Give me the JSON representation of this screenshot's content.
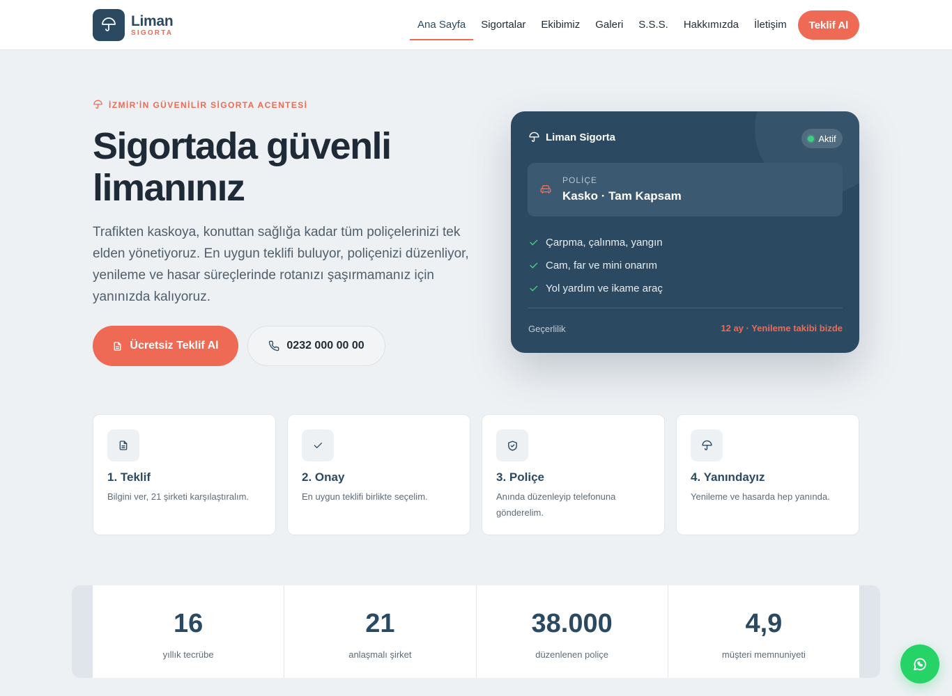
{
  "header": {
    "logo_name": "Liman",
    "logo_sub": "SIGORTA",
    "nav": [
      {
        "label": "Ana Sayfa",
        "active": true
      },
      {
        "label": "Sigortalar"
      },
      {
        "label": "Ekibimiz"
      },
      {
        "label": "Galeri"
      },
      {
        "label": "S.S.S."
      },
      {
        "label": "Hakkımızda"
      },
      {
        "label": "İletişim"
      }
    ],
    "cta_label": "Teklif Al"
  },
  "hero": {
    "eyebrow": "İZMİR'İN GÜVENİLİR SİGORTA ACENTESİ",
    "title": "Sigortada güvenli limanınız",
    "description": "Trafikten kaskoya, konuttan sağlığa kadar tüm poliçelerinizi tek elden yönetiyoruz. En uygun teklifi buluyor, poliçenizi düzenliyor, yenileme ve hasar süreçlerinde rotanızı şaşırmamanız için yanınızda kalıyoruz.",
    "primary_button": "Ücretsiz Teklif Al",
    "phone_button": "0232 000 00 00"
  },
  "policy_card": {
    "brand": "Liman Sigorta",
    "status": "Aktif",
    "policy_label": "POLİÇE",
    "policy_value": "Kasko · Tam Kapsam",
    "coverage": [
      "Çarpma, çalınma, yangın",
      "Cam, far ve mini onarım",
      "Yol yardım ve ikame araç"
    ],
    "validity_label": "Geçerlilik",
    "validity_value": "12 ay · Yenileme takibi bizde"
  },
  "steps": [
    {
      "title": "1. Teklif",
      "desc": "Bilgini ver, 21 şirketi karşılaştıralım.",
      "icon": "document-icon"
    },
    {
      "title": "2. Onay",
      "desc": "En uygun teklifi birlikte seçelim.",
      "icon": "check-icon"
    },
    {
      "title": "3. Poliçe",
      "desc": "Anında düzenleyip telefonuna gönderelim.",
      "icon": "shield-check-icon"
    },
    {
      "title": "4. Yanındayız",
      "desc": "Yenileme ve hasarda hep yanında.",
      "icon": "umbrella-icon"
    }
  ],
  "stats": [
    {
      "value": "16",
      "label": "yıllık tecrübe"
    },
    {
      "value": "21",
      "label": "anlaşmalı şirket"
    },
    {
      "value": "38.000",
      "label": "düzenlenen poliçe"
    },
    {
      "value": "4,9",
      "label": "müşteri memnuniyeti"
    }
  ],
  "colors": {
    "primary": "#2b4a62",
    "accent": "#ee6a54",
    "background": "#eef1f4",
    "success": "#25d366"
  }
}
